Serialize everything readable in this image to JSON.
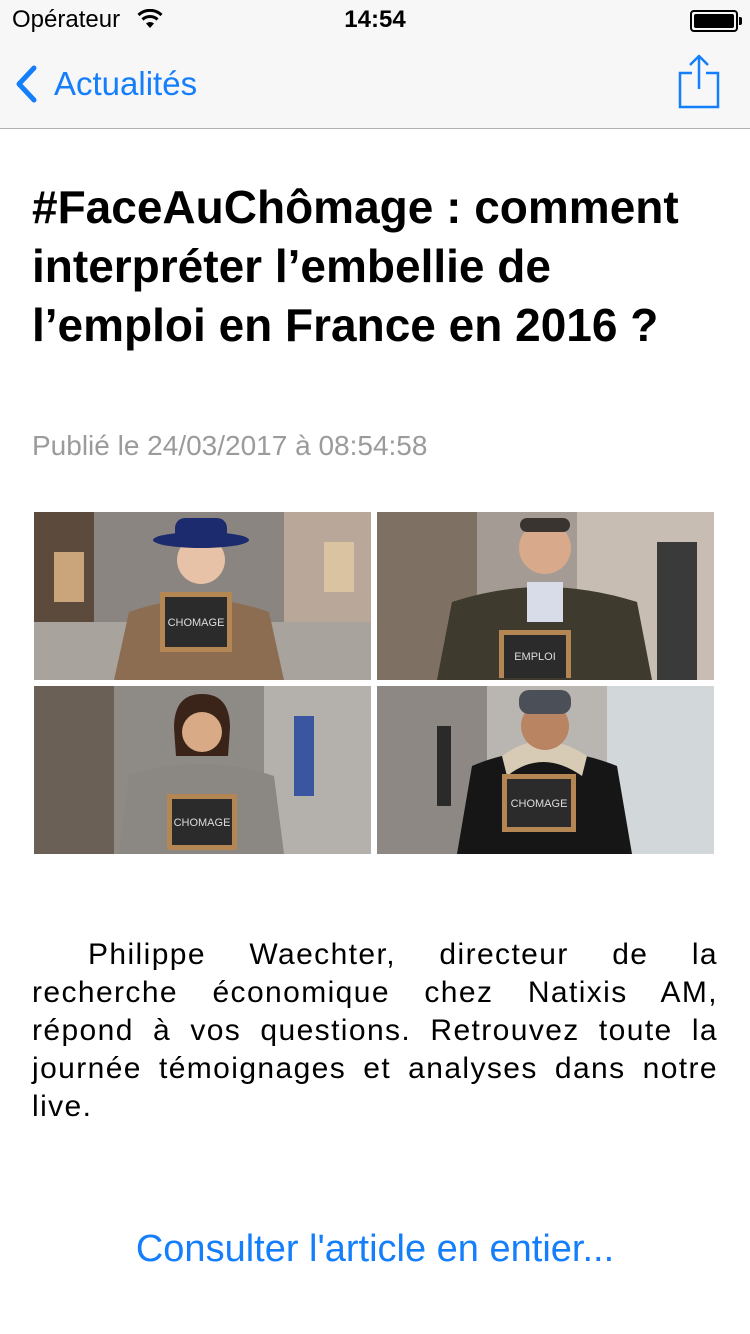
{
  "status_bar": {
    "carrier": "Opérateur",
    "time": "14:54"
  },
  "nav": {
    "back_label": "Actualités"
  },
  "article": {
    "title": "#FaceAuChômage : comment interpréter l’embellie de l’emploi en France en 2016 ?",
    "published": "Publié le 24/03/2017 à 08:54:58",
    "photo_chalkboards": [
      "CHOMAGE",
      "EMPLOI",
      "CHOMAGE",
      "CHOMAGE"
    ],
    "body": "Philippe Waechter, directeur de la recherche économique chez Natixis AM, répond à vos questions. Retrouvez toute la journée témoignages et analyses dans notre live.",
    "read_more": "Consulter l'article en entier..."
  },
  "colors": {
    "accent": "#147efb",
    "meta_gray": "#9b9b9b",
    "bar_bg": "#f7f7f7"
  },
  "icons": [
    "wifi-icon",
    "battery-icon",
    "chevron-left-icon",
    "share-icon"
  ]
}
